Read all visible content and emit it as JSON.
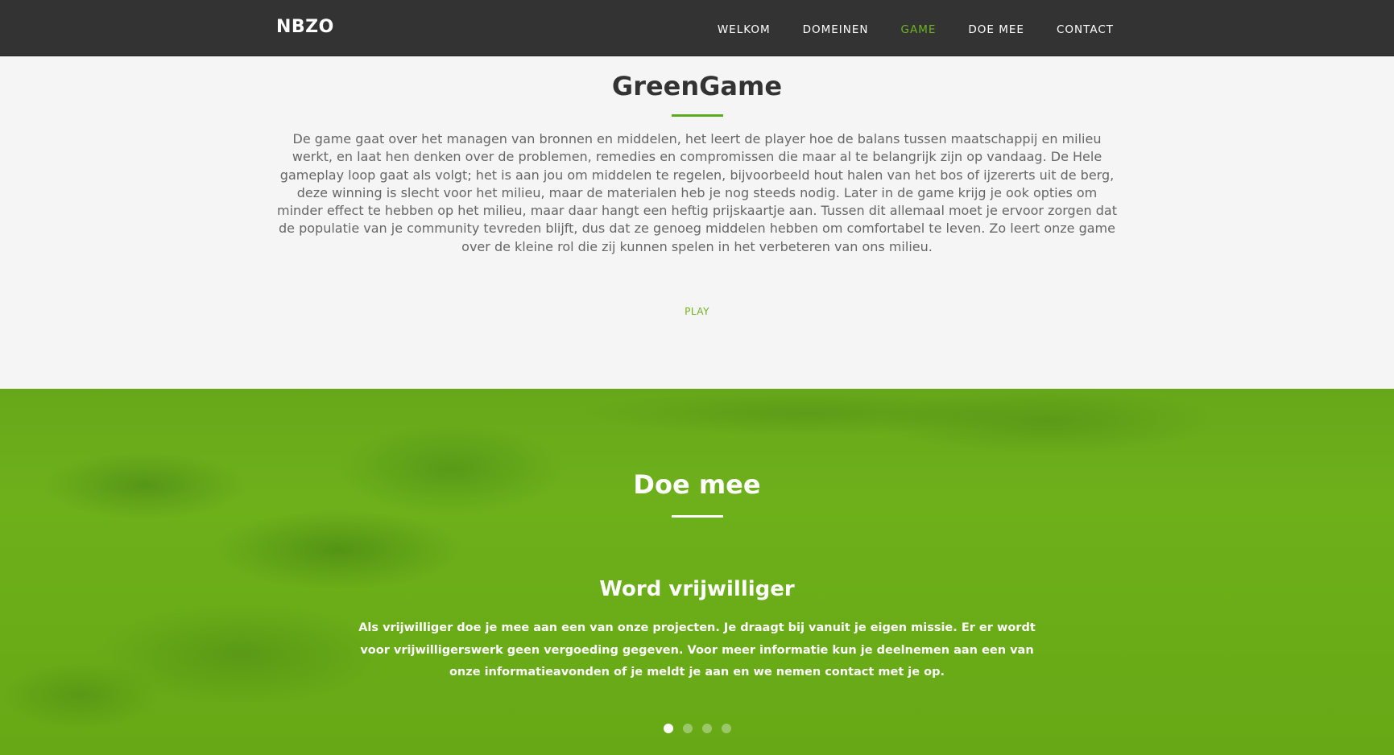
{
  "nav": {
    "brand": "NBZO",
    "links": [
      "WELKOM",
      "DOMEINEN",
      "GAME",
      "DOE MEE",
      "CONTACT"
    ],
    "active": "GAME"
  },
  "game": {
    "title": "GreenGame",
    "text": "De game gaat over het managen van bronnen en middelen, het leert de player hoe de balans tussen maatschappij en milieu werkt, en laat hen denken over de problemen, remedies en compromissen die maar al te belangrijk zijn op vandaag. De Hele gameplay loop gaat als volgt; het is aan jou om middelen te regelen, bijvoorbeeld hout halen van het bos of ijzererts uit de berg, deze winning is slecht voor het milieu, maar de materialen heb je nog steeds nodig. Later in de game krijg je ook opties om minder effect te hebben op het milieu, maar daar hangt een heftig prijskaartje aan. Tussen dit allemaal moet je ervoor zorgen dat de populatie van je community tevreden blijft, dus dat ze genoeg middelen hebben om comfortabel te leven. Zo leert onze game over de kleine rol die zij kunnen spelen in het verbeteren van ons milieu.",
    "play_label": "PLAY"
  },
  "join": {
    "title": "Doe mee",
    "slide_title": "Word vrijwilliger",
    "slide_text": "Als vrijwilliger doe je mee aan een van onze projecten. Je draagt bij vanuit je eigen missie. Er er wordt voor vrijwilligerswerk geen vergoeding gegeven. Voor meer informatie kun je deelnemen aan een van onze informatieavonden of je meldt je aan en we nemen contact met je op.",
    "slide_count": 4,
    "active_slide": 1
  },
  "colors": {
    "navbar": "#333333",
    "accent": "#6fb323",
    "green_section": "#6aad18",
    "body_text": "#666666"
  }
}
